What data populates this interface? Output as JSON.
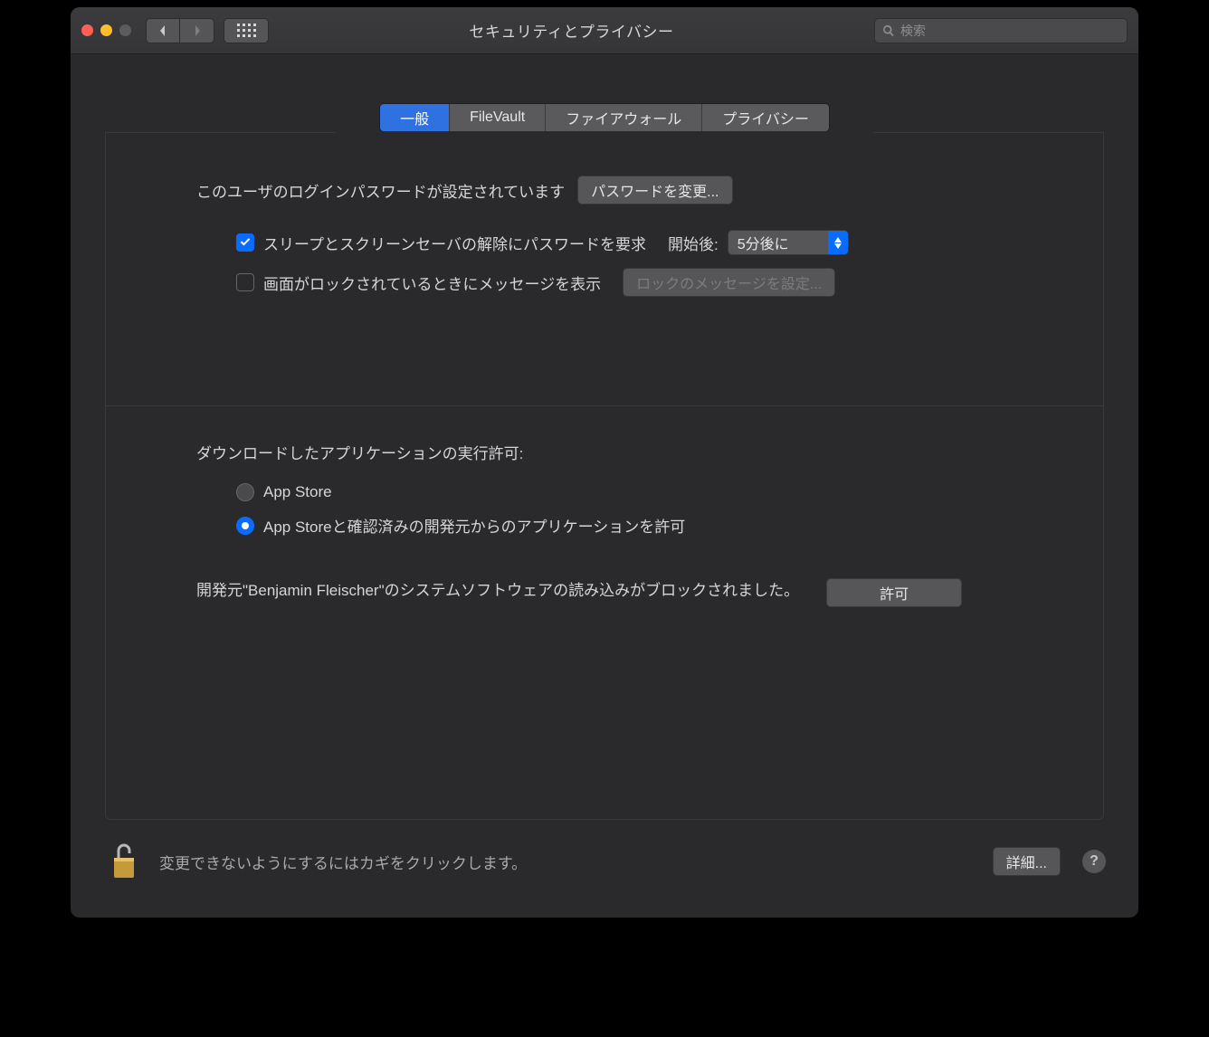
{
  "window": {
    "title": "セキュリティとプライバシー"
  },
  "toolbar": {
    "search_placeholder": "検索"
  },
  "tabs": [
    {
      "label": "一般",
      "active": true
    },
    {
      "label": "FileVault",
      "active": false
    },
    {
      "label": "ファイアウォール",
      "active": false
    },
    {
      "label": "プライバシー",
      "active": false
    }
  ],
  "general": {
    "login_password_text": "このユーザのログインパスワードが設定されています",
    "change_password_label": "パスワードを変更...",
    "require_password_checkbox_label": "スリープとスクリーンセーバの解除にパスワードを要求",
    "require_password_checked": true,
    "after_label": "開始後:",
    "delay_selected": "5分後に",
    "show_message_checkbox_label": "画面がロックされているときにメッセージを表示",
    "show_message_checked": false,
    "set_lock_message_label": "ロックのメッセージを設定...",
    "allow_apps_heading": "ダウンロードしたアプリケーションの実行許可:",
    "radio_appstore_label": "App Store",
    "radio_identified_label": "App Storeと確認済みの開発元からのアプリケーションを許可",
    "radio_selected": "identified",
    "blocked_text": "開発元\"Benjamin Fleischer\"のシステムソフトウェアの読み込みがブロックされました。",
    "allow_button_label": "許可"
  },
  "footer": {
    "lock_text": "変更できないようにするにはカギをクリックします。",
    "advanced_label": "詳細...",
    "help_label": "?"
  }
}
